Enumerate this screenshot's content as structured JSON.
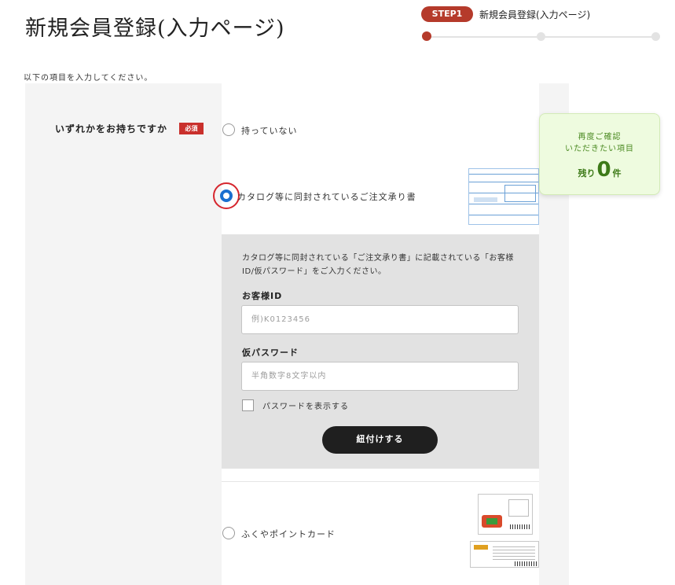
{
  "header": {
    "title": "新規会員登録(入力ページ)",
    "step_badge": "STEP1",
    "step_label": "新規会員登録(入力ページ)",
    "progress_current": 1,
    "progress_total": 3
  },
  "intro": "以下の項目を入力してください。",
  "question": {
    "label": "いずれかをお持ちですか",
    "required_badge": "必須"
  },
  "options": [
    {
      "label": "持っていない",
      "selected": false
    },
    {
      "label": "カタログ等に同封されているご注文承り書",
      "selected": true
    },
    {
      "label": "ふくやポイントカード",
      "selected": false
    }
  ],
  "catalog_form": {
    "description": "カタログ等に同封されている「ご注文承り書」に記載されている「お客様ID/仮パスワード」をご入力ください。",
    "customer_id_label": "お客様ID",
    "customer_id_placeholder": "例)K0123456",
    "password_label": "仮パスワード",
    "password_placeholder": "半角数字8文字以内",
    "show_password_label": "パスワードを表示する",
    "submit_label": "紐付けする"
  },
  "reminder": {
    "line1": "再度ご確認",
    "line2": "いただきたい項目",
    "remaining_prefix": "残り",
    "remaining_count": "0",
    "remaining_suffix": "件"
  },
  "colors": {
    "accent": "#b53a2b",
    "required": "#c9302c",
    "radio_selected": "#1a6fcf",
    "highlight": "#d6262e",
    "reminder_bg": "#eefbdf",
    "reminder_text": "#4b8a22"
  }
}
